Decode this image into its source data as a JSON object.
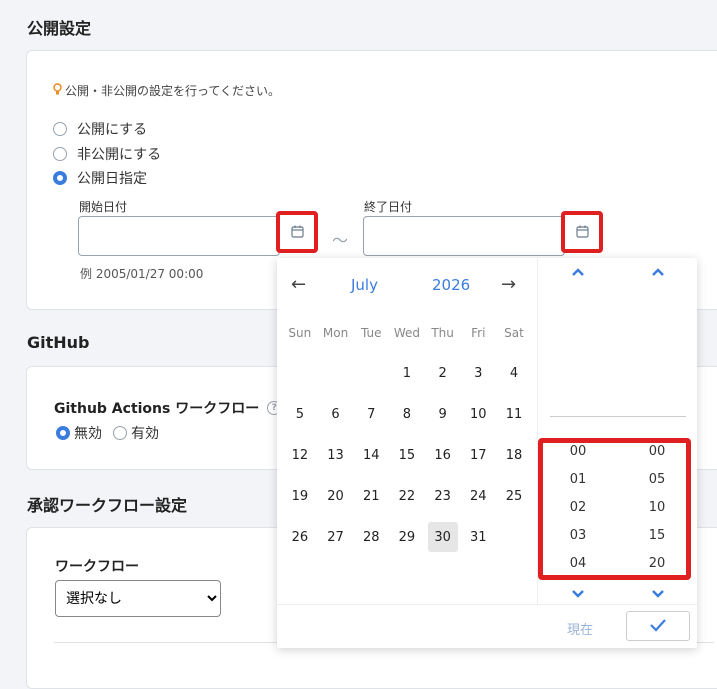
{
  "publish": {
    "title": "公開設定",
    "hint": "公開・非公開の設定を行ってください。",
    "options": [
      {
        "label": "公開にする",
        "selected": false
      },
      {
        "label": "非公開にする",
        "selected": false
      },
      {
        "label": "公開日指定",
        "selected": true
      }
    ],
    "start_label": "開始日付",
    "end_label": "終了日付",
    "tilde": "～",
    "example": "例 2005/01/27 00:00"
  },
  "github": {
    "title": "GitHub",
    "workflow_label": "Github Actions ワークフロー",
    "help": "?",
    "options": [
      {
        "label": "無効",
        "selected": true
      },
      {
        "label": "有効",
        "selected": false
      }
    ]
  },
  "approval": {
    "title": "承認ワークフロー設定",
    "workflow_label": "ワークフロー",
    "select_value": "選択なし"
  },
  "picker": {
    "prev": "←",
    "next": "→",
    "month": "July",
    "year": "2026",
    "weekdays": [
      "Sun",
      "Mon",
      "Tue",
      "Wed",
      "Thu",
      "Fri",
      "Sat"
    ],
    "weeks": [
      [
        "",
        "",
        "",
        "1",
        "2",
        "3",
        "4"
      ],
      [
        "5",
        "6",
        "7",
        "8",
        "9",
        "10",
        "11"
      ],
      [
        "12",
        "13",
        "14",
        "15",
        "16",
        "17",
        "18"
      ],
      [
        "19",
        "20",
        "21",
        "22",
        "23",
        "24",
        "25"
      ],
      [
        "26",
        "27",
        "28",
        "29",
        "30",
        "31",
        ""
      ]
    ],
    "today": "30",
    "hours": [
      "00",
      "01",
      "02",
      "03",
      "04"
    ],
    "minutes": [
      "00",
      "05",
      "10",
      "15",
      "20"
    ],
    "now_label": "現在",
    "accent": "#3b7ddd",
    "highlight": "#e02020"
  }
}
